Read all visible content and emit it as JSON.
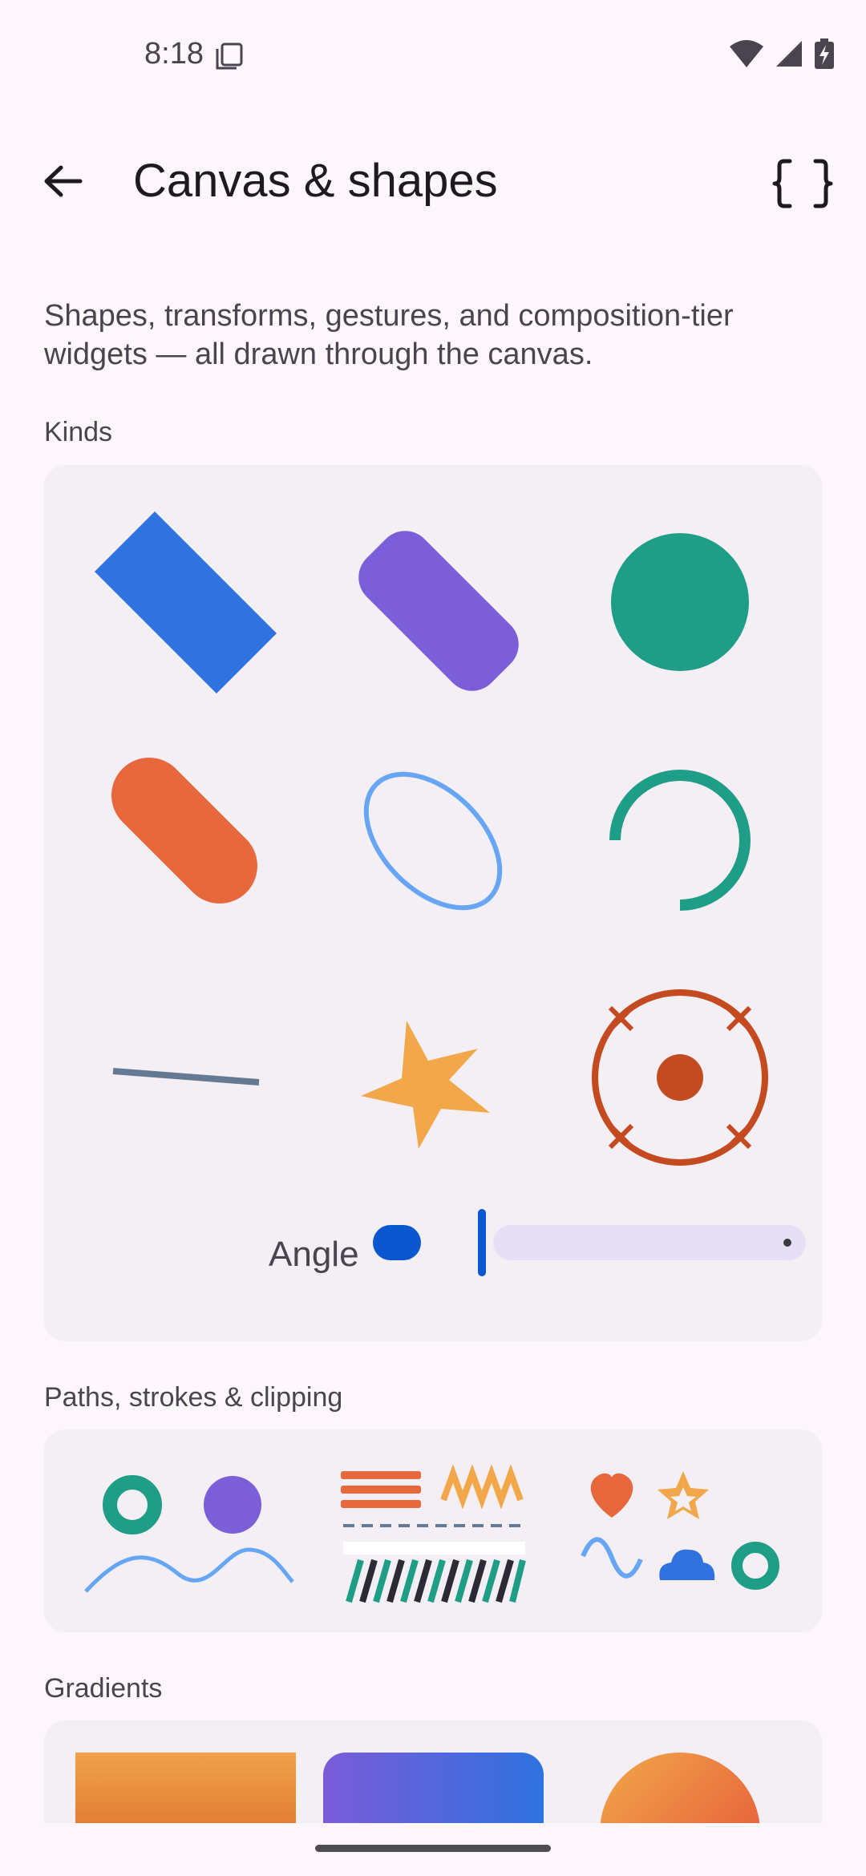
{
  "status": {
    "time": "8:18",
    "icons": [
      "screenshot-icon",
      "wifi-icon",
      "signal-icon",
      "battery-charging-icon"
    ]
  },
  "app_bar": {
    "title": "Canvas & shapes",
    "back_icon": "arrow-back-icon",
    "code_icon": "code-braces-icon"
  },
  "description": "Shapes, transforms, gestures, and composition-tier widgets — all drawn through the canvas.",
  "sections": {
    "kinds": "Kinds",
    "paths": "Paths, strokes & clipping",
    "gradients": "Gradients"
  },
  "kinds": {
    "shapes": [
      "rectangle",
      "rounded-rectangle",
      "circle",
      "capsule",
      "oval-outline",
      "arc",
      "line",
      "star",
      "target"
    ],
    "angle_label": "Angle",
    "angle_value": 0
  },
  "colors": {
    "blue": "#2f72e0",
    "purple": "#7b5ed8",
    "teal": "#1f9e87",
    "orange": "#e8683d",
    "light_blue": "#67a6f5",
    "slate": "#657993",
    "amber": "#f2a84a",
    "rust": "#c44a20",
    "slider_accent": "#0b57d0",
    "card_bg": "#f3eff4",
    "page_bg": "#fdf7fc"
  }
}
